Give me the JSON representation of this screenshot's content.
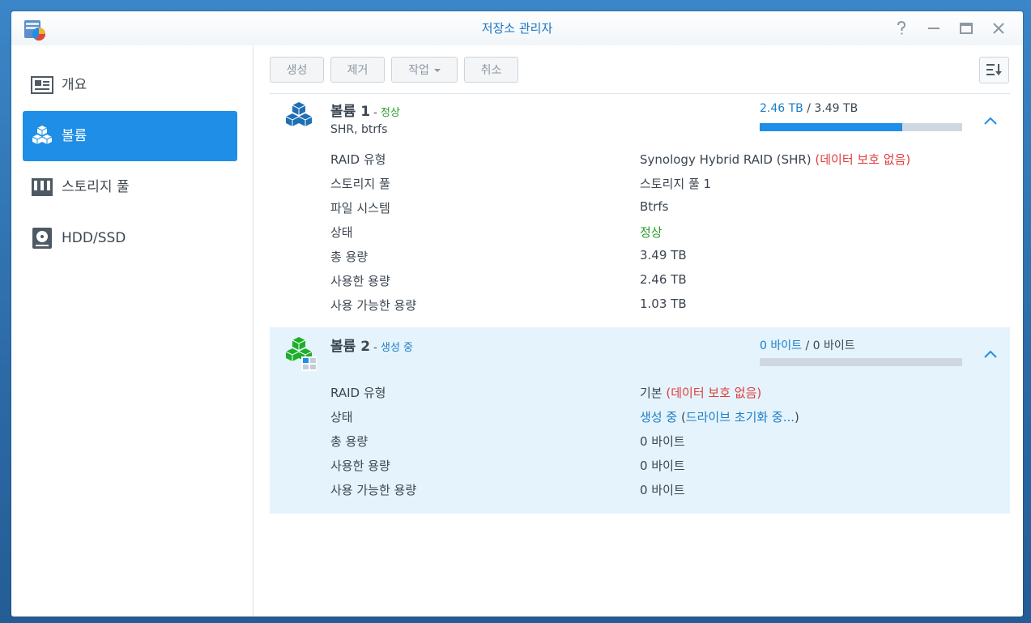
{
  "window": {
    "title": "저장소 관리자"
  },
  "sidebar": {
    "items": [
      {
        "label": "개요",
        "icon": "overview-icon"
      },
      {
        "label": "볼륨",
        "icon": "volume-icon",
        "active": true
      },
      {
        "label": "스토리지 풀",
        "icon": "storage-pool-icon"
      },
      {
        "label": "HDD/SSD",
        "icon": "hdd-icon"
      }
    ]
  },
  "toolbar": {
    "create_label": "생성",
    "remove_label": "제거",
    "action_label": "작업",
    "cancel_label": "취소"
  },
  "volumes": [
    {
      "name": "볼륨 1",
      "dash": " - ",
      "status": "정상",
      "subtitle": "SHR, btrfs",
      "used": "2.46 TB",
      "sep": " / ",
      "total": "3.49 TB",
      "used_fraction": 0.705,
      "rows": [
        {
          "key": "RAID 유형",
          "value": "Synology Hybrid RAID (SHR)",
          "note": " (데이터 보호 없음)"
        },
        {
          "key": "스토리지 풀",
          "value": "스토리지 풀 1"
        },
        {
          "key": "파일 시스템",
          "value": "Btrfs"
        },
        {
          "key": "상태",
          "value": "정상"
        },
        {
          "key": "총 용량",
          "value": "3.49 TB"
        },
        {
          "key": "사용한 용량",
          "value": "2.46 TB"
        },
        {
          "key": "사용 가능한 용량",
          "value": "1.03 TB"
        }
      ]
    },
    {
      "name": "볼륨 2",
      "dash": " - ",
      "status": "생성 중",
      "used": "0 바이트",
      "sep": " / ",
      "total": "0 바이트",
      "used_fraction": 0,
      "rows": [
        {
          "key": "RAID 유형",
          "value": "기본",
          "note": " (데이터 보호 없음)"
        },
        {
          "key": "상태",
          "value": "생성 중",
          "note_open": " (",
          "note": "드라이브 초기화 중...",
          "note_close": ")"
        },
        {
          "key": "총 용량",
          "value": "0 바이트"
        },
        {
          "key": "사용한 용량",
          "value": "0 바이트"
        },
        {
          "key": "사용 가능한 용량",
          "value": "0 바이트"
        }
      ]
    }
  ],
  "colors": {
    "accent": "#1e8ee6",
    "ok": "#2b9a2b",
    "warning": "#e03c3c",
    "running": "#1b7ec9"
  }
}
